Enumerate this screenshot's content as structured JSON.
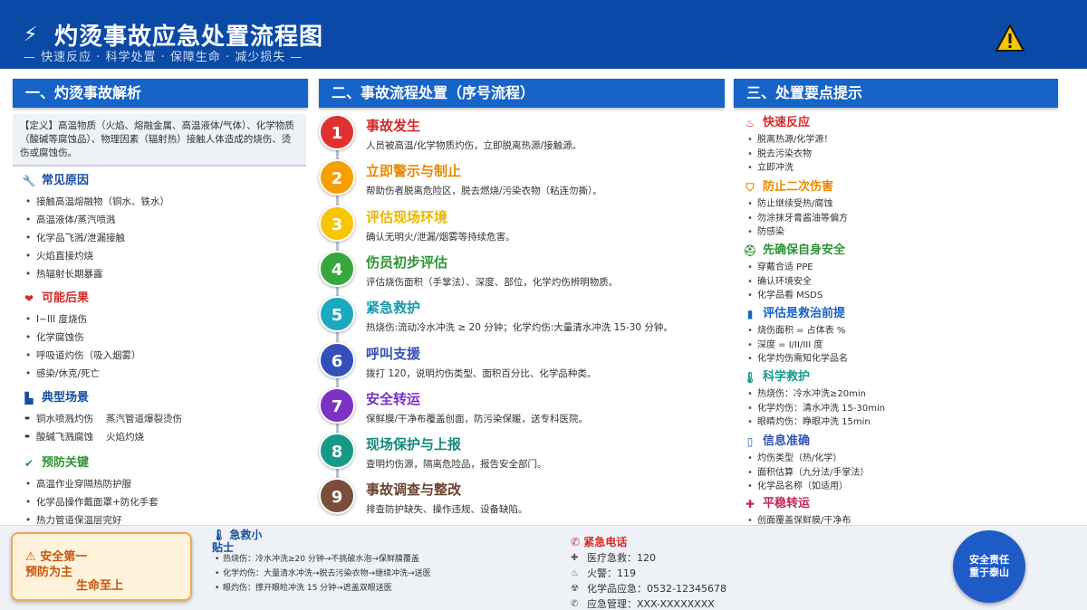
{
  "header": {
    "title": "灼烫事故应急处置流程图",
    "subtitle": "— 快速反应 · 科学处置 · 保障生命 · 减少损失 —"
  },
  "sections": {
    "s1": "一、灼烫事故解析",
    "s2": "二、事故流程处置（序号流程）",
    "s3": "三、处置要点提示"
  },
  "definition": "【定义】高温物质（火焰、熔融金属、高温液体/气体）、化学物质（酸碱等腐蚀品）、物理因素（辐射热）接触人体造成的烧伤、烫伤或腐蚀伤。",
  "causes": {
    "title": "常见原因",
    "items": [
      "接触高温熔融物（铜水、铁水）",
      "高温液体/蒸汽喷溅",
      "化学品飞溅/泄漏接触",
      "火焰直接灼烧",
      "热辐射长期暴露"
    ]
  },
  "consequences": {
    "title": "可能后果",
    "items": [
      "I~III 度烧伤",
      "化学腐蚀伤",
      "呼吸道灼伤（吸入烟雾）",
      "感染/休克/死亡"
    ]
  },
  "scenes": {
    "title": "典型场景",
    "row1": [
      "铜水喷溅灼伤",
      "蒸汽管道爆裂烫伤"
    ],
    "row2": [
      "酸碱飞溅腐蚀",
      "火焰灼烧"
    ]
  },
  "prevention": {
    "title": "预防关键",
    "items": [
      "高温作业穿隔热防护服",
      "化学品操作戴面罩+防化手套",
      "热力管道保温层完好"
    ]
  },
  "steps": [
    {
      "num": "1",
      "title": "事故发生",
      "desc": "人员被高温/化学物质灼伤，立即脱离热源/接触源。",
      "color": "#e03131",
      "title_color": "#d42a2a"
    },
    {
      "num": "2",
      "title": "立即警示与制止",
      "desc": "帮助伤者脱离危险区，脱去燃烧/污染衣物（粘连勿撕）。",
      "color": "#f59f00",
      "title_color": "#e68a00"
    },
    {
      "num": "3",
      "title": "评估现场环境",
      "desc": "确认无明火/泄漏/烟雾等持续危害。",
      "color": "#f7c600",
      "title_color": "#e8b800"
    },
    {
      "num": "4",
      "title": "伤员初步评估",
      "desc": "评估烧伤面积（手掌法）、深度、部位，化学灼伤辨明物质。",
      "color": "#37a73d",
      "title_color": "#2f9436"
    },
    {
      "num": "5",
      "title": "紧急救护",
      "desc": "热烧伤:流动冷水冲洗 ≥ 20 分钟；化学灼伤:大量清水冲洗 15-30 分钟。",
      "color": "#1ba9c0",
      "title_color": "#1798ad"
    },
    {
      "num": "6",
      "title": "呼叫支援",
      "desc": "拨打 120，说明灼伤类型、面积百分比、化学品种类。",
      "color": "#3450b8",
      "title_color": "#3450b8"
    },
    {
      "num": "7",
      "title": "安全转运",
      "desc": "保鲜膜/干净布覆盖创面，防污染保暖，送专科医院。",
      "color": "#7a33c4",
      "title_color": "#7a33c4"
    },
    {
      "num": "8",
      "title": "现场保护与上报",
      "desc": "查明灼伤源，隔离危险品，报告安全部门。",
      "color": "#17998a",
      "title_color": "#148a7c"
    },
    {
      "num": "9",
      "title": "事故调查与整改",
      "desc": "排查防护缺失、操作违规、设备缺陷。",
      "color": "#7a4e3a",
      "title_color": "#6b4332"
    }
  ],
  "points": [
    {
      "title": "快速反应",
      "color": "#d42a2a",
      "icon": "alarm-icon",
      "glyph": "♨",
      "items": [
        "脱离热源/化学源！",
        "脱去污染衣物",
        "立即冲洗"
      ]
    },
    {
      "title": "防止二次伤害",
      "color": "#e68a00",
      "icon": "shield-icon",
      "glyph": "⛉",
      "items": [
        "防止继续受热/腐蚀",
        "勿涂抹牙膏酱油等偏方",
        "防感染"
      ]
    },
    {
      "title": "先确保自身安全",
      "color": "#2f9436",
      "icon": "helmet-icon",
      "glyph": "⛑",
      "items": [
        "穿戴合适 PPE",
        "确认环境安全",
        "化学品看 MSDS"
      ]
    },
    {
      "title": "评估是救治前提",
      "color": "#1764c8",
      "icon": "clipboard-icon",
      "glyph": "▮",
      "items": [
        "烧伤面积 = 占体表 %",
        "深度 = I/II/III 度",
        "化学灼伤需知化学品名"
      ]
    },
    {
      "title": "科学救护",
      "color": "#17998a",
      "icon": "thermometer-icon",
      "glyph": "🌡",
      "items": [
        "热烧伤：冷水冲洗≥20min",
        "化学灼伤：清水冲洗 15-30min",
        "眼睛灼伤：睁眼冲洗 15min"
      ]
    },
    {
      "title": "信息准确",
      "color": "#3450b8",
      "icon": "document-icon",
      "glyph": "▯",
      "items": [
        "灼伤类型（热/化学）",
        "面积估算（九分法/手掌法）",
        "化学品名称（如适用）"
      ]
    },
    {
      "title": "平稳转运",
      "color": "#c2255c",
      "icon": "ambulance-icon",
      "glyph": "✚",
      "items": [
        "创面覆盖保鲜膜/干净布"
      ]
    }
  ],
  "footer": {
    "safety": {
      "l1": "安全第一",
      "l2": "预防为主",
      "l3": "生命至上"
    },
    "tips": {
      "title": "急救小贴士",
      "items": [
        "热烧伤：冷水冲洗≥20 分钟→不挑破水泡→保鲜膜覆盖",
        "化学灼伤：大量清水冲洗→脱去污染衣物→继续冲洗→送医",
        "眼灼伤：撑开眼睑冲洗 15 分钟→遮盖双眼送医"
      ]
    },
    "emergency": {
      "title": "紧急电话",
      "rows": [
        {
          "label": "医疗急救：120",
          "icon": "hospital-icon",
          "glyph": "✚"
        },
        {
          "label": "火警：119",
          "icon": "fire-icon",
          "glyph": "♨"
        },
        {
          "label": "化学品应急：0532-12345678",
          "icon": "hazard-icon",
          "glyph": "☢"
        },
        {
          "label": "应急管理：XXX-XXXXXXXX",
          "icon": "phone-icon",
          "glyph": "✆"
        }
      ]
    },
    "seal": {
      "l1": "安全责任",
      "l2": "重于泰山"
    }
  }
}
